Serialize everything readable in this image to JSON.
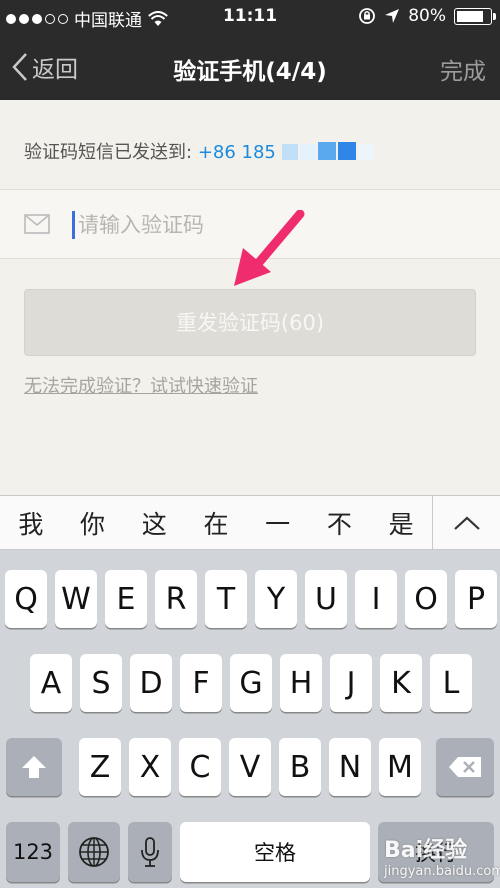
{
  "status_bar": {
    "carrier": "中国联通",
    "time": "11:11",
    "battery": "80%",
    "battery_level": 0.8,
    "icons": [
      "signal-dots-icon",
      "wifi-icon",
      "orientation-lock-icon",
      "location-arrow-icon",
      "battery-icon"
    ]
  },
  "nav": {
    "back_label": "返回",
    "title": "验证手机(4/4)",
    "done_label": "完成"
  },
  "content": {
    "sent_prefix": "验证码短信已发送到:",
    "phone_number": "+86 185",
    "code_input": {
      "value": "",
      "placeholder": "请输入验证码"
    },
    "resend_label": "重发验证码(60)",
    "quick_verify_link": "无法完成验证？试试快速验证"
  },
  "colors": {
    "nav_bg": "#2b2b2b",
    "page_bg": "#f3f1ec",
    "link_blue": "#1a8be0",
    "arrow_pink": "#ef2c6e",
    "caret": "#3a6fe0"
  },
  "suggestions": [
    "我",
    "你",
    "这",
    "在",
    "一",
    "不",
    "是"
  ],
  "keyboard": {
    "row1": [
      "Q",
      "W",
      "E",
      "R",
      "T",
      "Y",
      "U",
      "I",
      "O",
      "P"
    ],
    "row2": [
      "A",
      "S",
      "D",
      "F",
      "G",
      "H",
      "J",
      "K",
      "L"
    ],
    "row3": [
      "Z",
      "X",
      "C",
      "V",
      "B",
      "N",
      "M"
    ],
    "numbers_label": "123",
    "space_label": "空格",
    "return_label": "换行"
  },
  "watermark": {
    "brand": "Bai",
    "suffix": "经验",
    "url": "jingyan.baidu.com"
  }
}
